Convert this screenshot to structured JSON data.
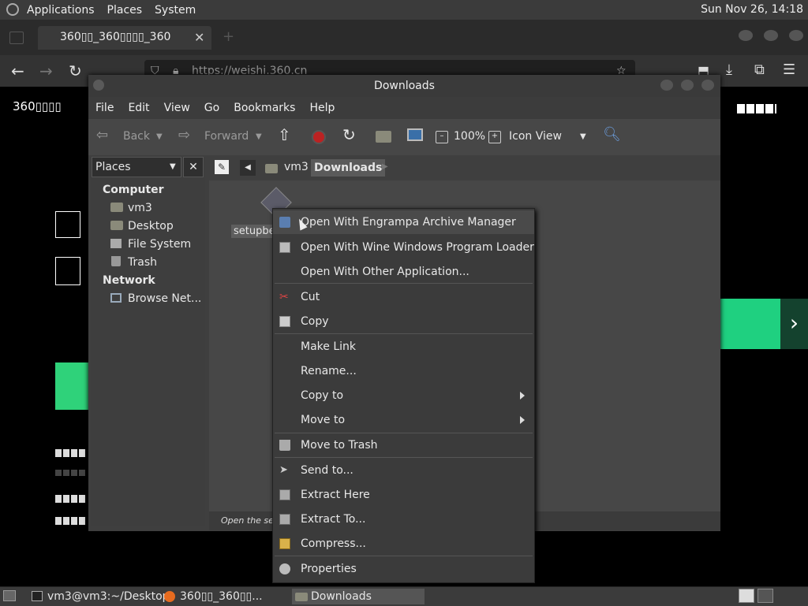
{
  "top_panel": {
    "applications": "Applications",
    "places": "Places",
    "system": "System",
    "clock": "Sun Nov 26, 14:18"
  },
  "browser": {
    "tab_title": "360▯▯_360▯▯▯▯_360",
    "url": "https://weishi.360.cn",
    "site_logo_text": "360▯▯▯▯"
  },
  "file_manager": {
    "title": "Downloads",
    "menu": [
      "File",
      "Edit",
      "View",
      "Go",
      "Bookmarks",
      "Help"
    ],
    "toolbar": {
      "back": "Back",
      "forward": "Forward",
      "zoom": "100%",
      "view_mode": "Icon View"
    },
    "sidebar": {
      "combo": "Places",
      "computer_header": "Computer",
      "network_header": "Network",
      "items": [
        "vm3",
        "Desktop",
        "File System",
        "Trash"
      ],
      "network_items": [
        "Browse Net..."
      ]
    },
    "pathbar": [
      "vm3",
      "Downloads"
    ],
    "file_label": "setupbe",
    "status": "Open the sele"
  },
  "context_menu": {
    "items": [
      "Open With Engrampa Archive Manager",
      "Open With Wine Windows Program Loader",
      "Open With Other Application...",
      "Cut",
      "Copy",
      "Make Link",
      "Rename...",
      "Copy to",
      "Move to",
      "Move to Trash",
      "Send to...",
      "Extract Here",
      "Extract To...",
      "Compress...",
      "Properties"
    ]
  },
  "taskbar": {
    "items": [
      "vm3@vm3:~/Desktop",
      "360▯▯_360▯▯...",
      "Downloads"
    ]
  },
  "colors": {
    "panel": "#3b3b3b",
    "accent_green": "#1fd080",
    "highlight": "#4a4a4a"
  }
}
